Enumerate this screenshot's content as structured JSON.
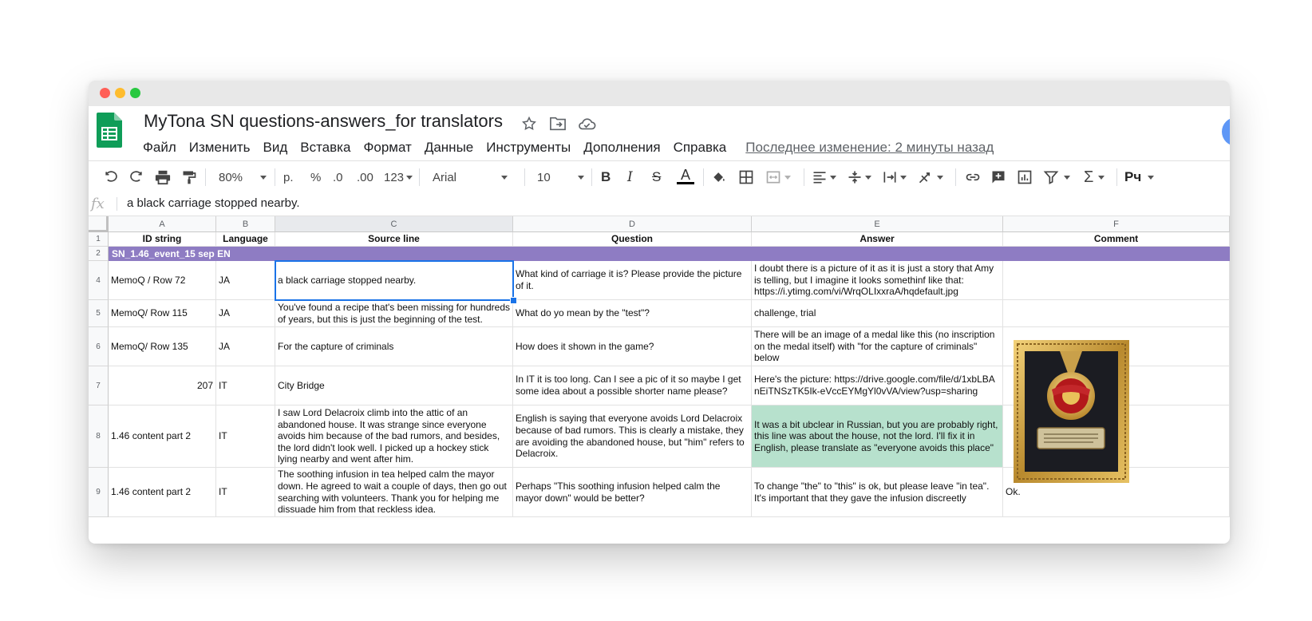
{
  "app": {
    "title": "MyTona SN questions-answers_for translators",
    "last_edit": "Последнее изменение: 2 минуты назад"
  },
  "menu": [
    "Файл",
    "Изменить",
    "Вид",
    "Вставка",
    "Формат",
    "Данные",
    "Инструменты",
    "Дополнения",
    "Справка"
  ],
  "toolbar": {
    "zoom": "80%",
    "currency": "р.",
    "percent": "%",
    "dec_decrease": ".0",
    "dec_increase": ".00",
    "more_formats": "123",
    "font": "Arial",
    "font_size": "10",
    "bold": "B",
    "italic": "I",
    "strike": "S",
    "text_color": "A"
  },
  "formula_bar": {
    "fx": "fx",
    "value": "a black carriage stopped nearby."
  },
  "columns": [
    "A",
    "B",
    "C",
    "D",
    "E",
    "F"
  ],
  "header_row": {
    "num": "1",
    "cells": [
      "ID string",
      "Language",
      "Source line",
      "Question",
      "Answer",
      "Comment"
    ]
  },
  "group_row": {
    "num": "2",
    "label": "SN_1.46_event_15 sep EN"
  },
  "rows": [
    {
      "num": "4",
      "a": "MemoQ / Row 72",
      "b": "JA",
      "c": "a black carriage stopped nearby.",
      "d": "What kind of carriage it is? Please provide the picture of it.",
      "e": "I doubt there is a picture of it as it is just a story that Amy is telling, but I imagine it looks somethinf like that: https://i.ytimg.com/vi/WrqOLIxxraA/hqdefault.jpg",
      "f": ""
    },
    {
      "num": "5",
      "a": "MemoQ/ Row 115",
      "b": "JA",
      "c": "You've found a recipe that's been missing for hundreds of years, but this is just the beginning of the test.",
      "d": "What do yo mean by the \"test\"?",
      "e": "challenge, trial",
      "f": ""
    },
    {
      "num": "6",
      "a": "MemoQ/ Row 135",
      "b": "JA",
      "c": "For the capture of criminals",
      "d": "How does it shown in the game?",
      "e": "There will be an image of a medal like this (no inscription on the medal itself) with \"for the capture of criminals\" below",
      "f": ""
    },
    {
      "num": "7",
      "a": "207",
      "b": "IT",
      "c": "City Bridge",
      "d": "In IT it is too long. Can I see a pic of it so maybe I get some idea about a possible shorter name please?",
      "e": "Here's the picture: https://drive.google.com/file/d/1xbLBAnEiTNSzTK5Ik-eVccEYMgYl0vVA/view?usp=sharing",
      "f": ""
    },
    {
      "num": "8",
      "a": "1.46 content part 2",
      "b": "IT",
      "c": "I saw Lord Delacroix climb into the attic of an abandoned house. It was strange since everyone avoids him because of the bad rumors, and besides, the lord didn't look well. I picked up a hockey stick lying nearby and went after him.",
      "d": "English is saying that everyone avoids Lord Delacroix because of bad rumors. This is clearly a mistake, they are avoiding the abandoned house, but \"him\" refers to Delacroix.",
      "e": "It was a bit ubclear in Russian, but you are probably right, this line was about the house, not the lord. I'll fix it in English, please translate as \"everyone avoids this place\"",
      "f": ""
    },
    {
      "num": "9",
      "a": "1.46 content part 2",
      "b": "IT",
      "c": "The soothing infusion in tea helped calm the mayor down. He agreed to wait a couple of days, then go out searching with volunteers. Thank you for helping me dissuade him from that reckless idea.",
      "d": "Perhaps \"This soothing infusion helped calm the mayor down\" would be better?",
      "e": "To change \"the\" to \"this\" is ok, but please leave \"in tea\". It's important that they gave the infusion discreetly",
      "f": "Ok."
    }
  ],
  "colors": {
    "group_band": "#8e7cc3",
    "answer_highlight": "#b7e1cd",
    "selection": "#1a73e8",
    "sheets_green": "#0f9d58"
  }
}
